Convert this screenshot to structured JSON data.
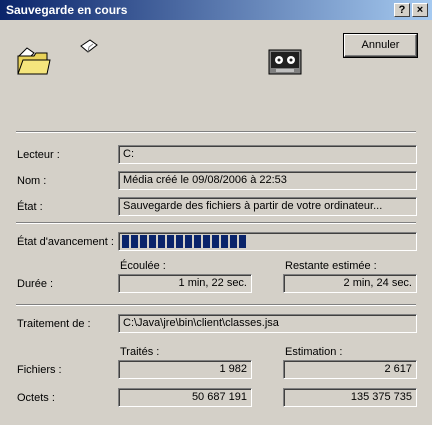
{
  "window": {
    "title": "Sauvegarde en cours",
    "help_label": "?",
    "close_label": "×"
  },
  "buttons": {
    "cancel": "Annuler"
  },
  "icons": {
    "folder": "folder-icon",
    "paper": "paper-icon",
    "tape": "tape-drive-icon"
  },
  "fields": {
    "drive": {
      "label": "Lecteur :",
      "value": "C:"
    },
    "name": {
      "label": "Nom :",
      "value": "Média créé le 09/08/2006 à 22:53"
    },
    "state": {
      "label": "État :",
      "value": "Sauvegarde des fichiers à partir de votre ordinateur..."
    }
  },
  "progress": {
    "label": "État d'avancement :",
    "segments": 14
  },
  "duration": {
    "label": "Durée :",
    "elapsed_header": "Écoulée :",
    "remaining_header": "Restante estimée :",
    "elapsed": "1 min, 22 sec.",
    "remaining": "2 min, 24 sec."
  },
  "processing": {
    "label": "Traitement de :",
    "value": "C:\\Java\\jre\\bin\\client\\classes.jsa"
  },
  "stats": {
    "processed_header": "Traités :",
    "estimate_header": "Estimation :",
    "files_label": "Fichiers :",
    "bytes_label": "Octets :",
    "files_processed": "1 982",
    "files_estimate": "2 617",
    "bytes_processed": "50 687 191",
    "bytes_estimate": "135 375 735"
  }
}
